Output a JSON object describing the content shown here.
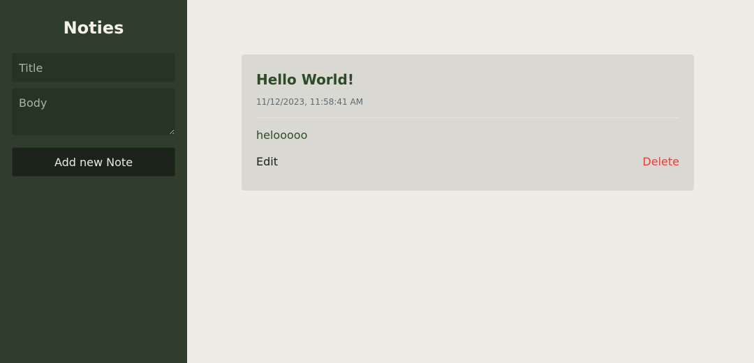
{
  "app": {
    "title": "Noties"
  },
  "form": {
    "title_placeholder": "Title",
    "title_value": "",
    "body_placeholder": "Body",
    "body_value": "",
    "add_label": "Add new Note"
  },
  "notes": [
    {
      "title": "Hello World!",
      "date": "11/12/2023, 11:58:41 AM",
      "body": "helooooo",
      "edit_label": "Edit",
      "delete_label": "Delete"
    }
  ],
  "colors": {
    "sidebar_bg": "#2f3e2c",
    "main_bg": "#efebe6",
    "card_bg": "#dad8d3",
    "accent_green": "#2d4c26",
    "delete_red": "#e0403b"
  }
}
